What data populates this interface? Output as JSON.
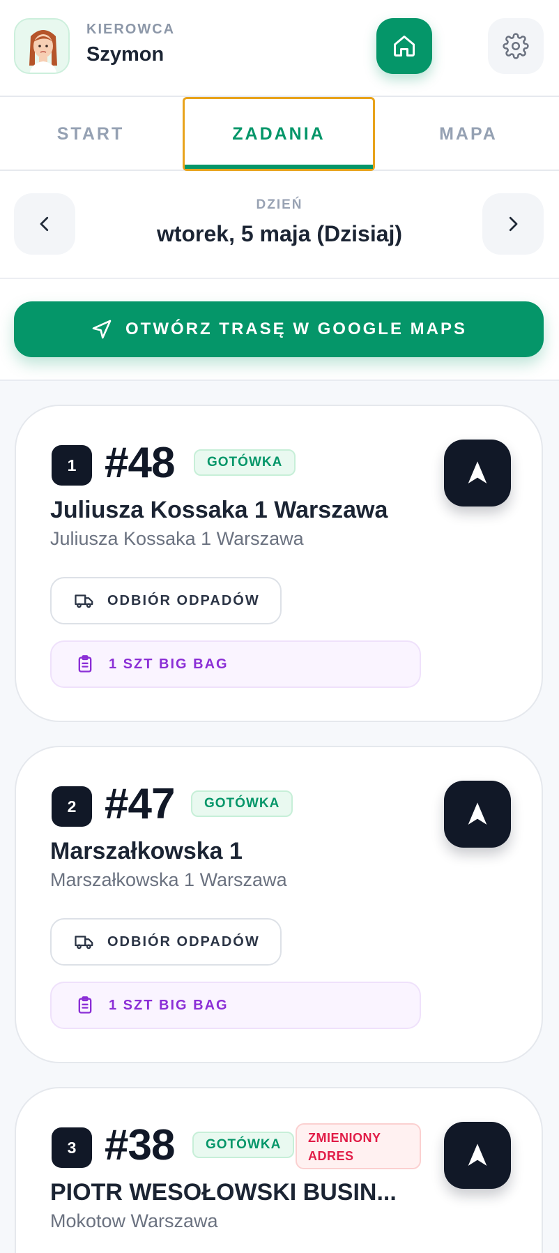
{
  "header": {
    "role": "KIEROWCA",
    "driver_name": "Szymon",
    "icons": {
      "avatar": "driver-avatar",
      "home": "home-icon",
      "settings": "gear-icon"
    }
  },
  "tabs": [
    {
      "label": "START",
      "active": false
    },
    {
      "label": "ZADANIA",
      "active": true
    },
    {
      "label": "MAPA",
      "active": false
    }
  ],
  "day": {
    "label": "DZIEŃ",
    "value": "wtorek, 5 maja (Dzisiaj)"
  },
  "route_button": {
    "label": "OTWÓRZ TRASĘ W GOOGLE MAPS",
    "icon": "navigation-arrow-icon"
  },
  "colors": {
    "accent": "#059669",
    "dark": "#111827",
    "focus_outline": "#e8a31c",
    "item_purple": "#8b2fd6",
    "warning_red": "#e11d48"
  },
  "tasks": [
    {
      "stop": "1",
      "order": "#48",
      "payment": "GOTÓWKA",
      "title": "Juliusza Kossaka 1 Warszawa",
      "address": "Juliusza Kossaka 1 Warszawa",
      "service": "ODBIÓR ODPADÓW",
      "item": "1 SZT BIG BAG"
    },
    {
      "stop": "2",
      "order": "#47",
      "payment": "GOTÓWKA",
      "title": "Marszałkowska 1",
      "address": "Marszałkowska 1 Warszawa",
      "service": "ODBIÓR ODPADÓW",
      "item": "1 SZT BIG BAG"
    },
    {
      "stop": "3",
      "order": "#38",
      "payment": "GOTÓWKA",
      "warning": "ZMIENIONY ADRES",
      "title": "PIOTR WESOŁOWSKI BUSIN...",
      "address": "Mokotow Warszawa"
    }
  ]
}
